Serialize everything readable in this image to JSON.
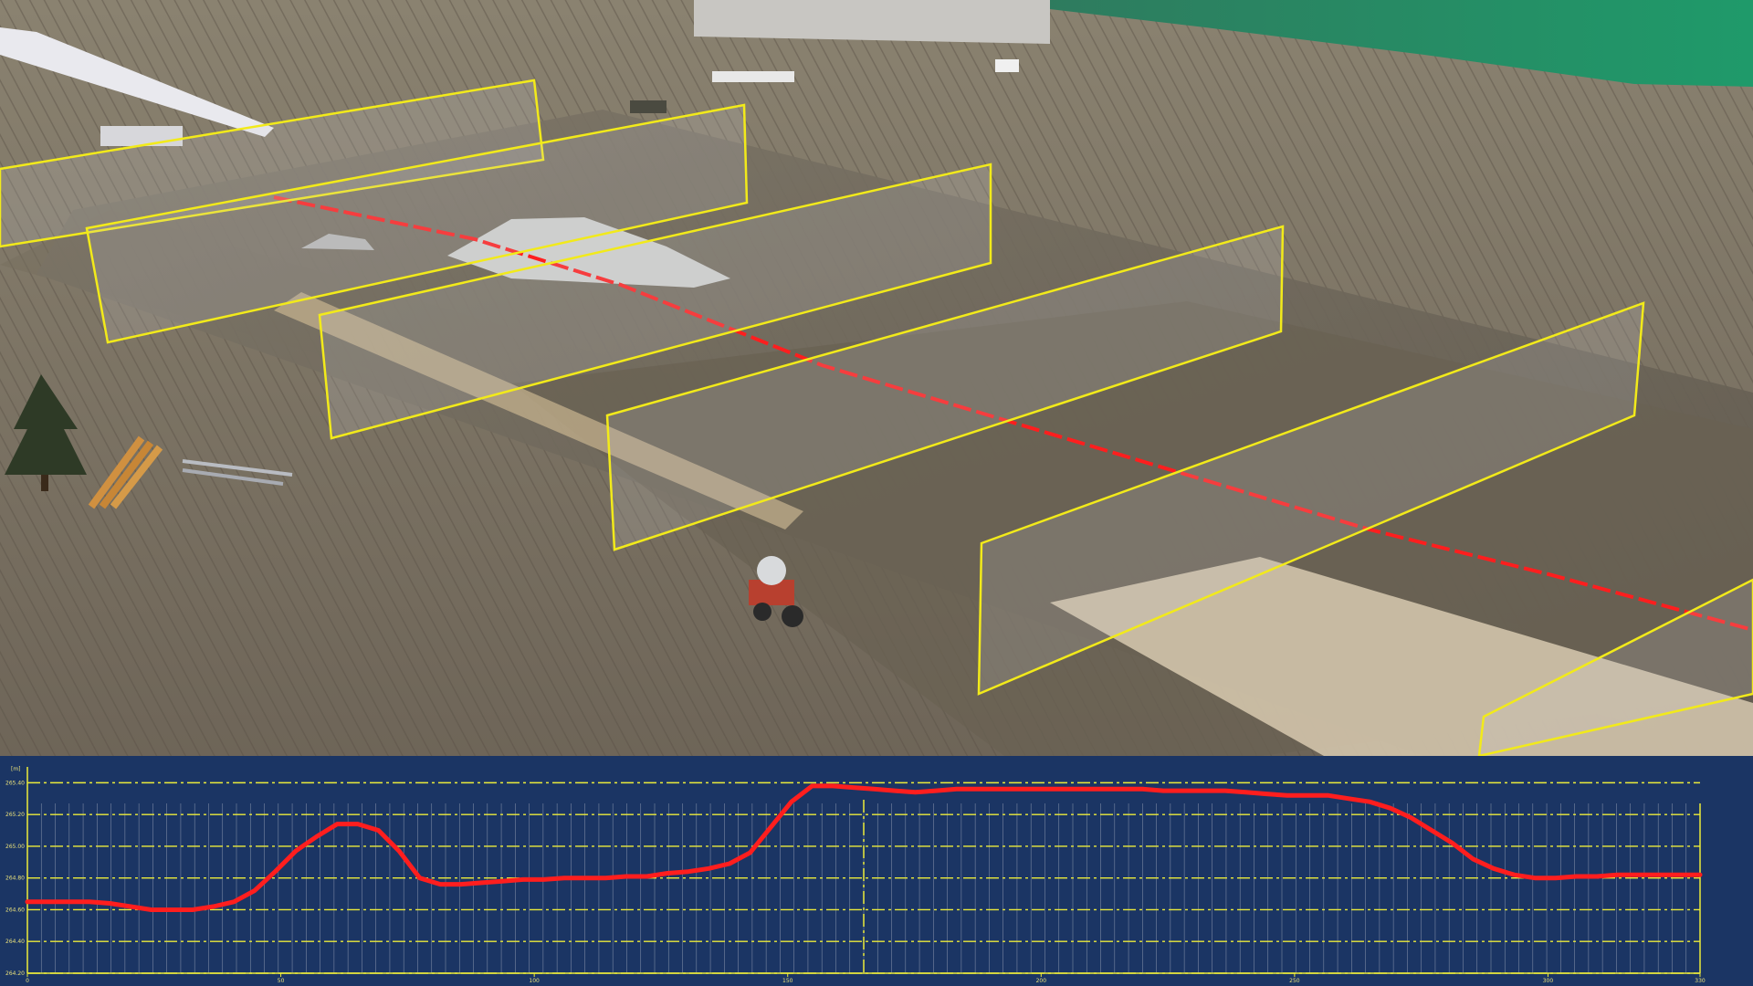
{
  "chart_data": {
    "type": "line",
    "title": "",
    "xlabel": "",
    "ylabel": "",
    "y_unit_label": "[m]",
    "x": [
      0,
      5,
      10,
      15,
      20,
      25,
      30,
      35,
      40,
      45,
      50,
      55,
      60,
      65,
      70,
      75,
      80,
      85,
      90,
      95,
      100,
      105,
      110,
      115,
      120,
      125,
      130,
      135,
      140,
      145,
      150,
      155,
      160,
      165,
      170,
      175,
      180,
      185,
      190,
      195,
      200,
      205,
      210,
      215,
      220,
      225,
      230,
      235,
      240,
      245,
      250,
      255,
      260,
      265,
      270,
      275,
      280,
      285,
      290,
      295,
      300,
      305,
      310,
      315,
      320,
      325,
      330
    ],
    "xlim": [
      0,
      330
    ],
    "x_tick_labels": [
      "0",
      "50",
      "100",
      "150",
      "200",
      "250",
      "300",
      "330"
    ],
    "y_tick_labels": [
      "264.20",
      "264.40",
      "264.60",
      "264.80",
      "265.00",
      "265.20",
      "265.40"
    ],
    "ylim": [
      264.2,
      265.5
    ],
    "series": [
      {
        "color": "#ff1e1e",
        "values": [
          264.65,
          264.65,
          264.65,
          264.65,
          264.64,
          264.62,
          264.6,
          264.6,
          264.6,
          264.62,
          264.65,
          264.72,
          264.84,
          264.97,
          265.06,
          265.14,
          265.14,
          265.1,
          264.97,
          264.8,
          264.76,
          264.76,
          264.77,
          264.78,
          264.79,
          264.79,
          264.8,
          264.8,
          264.8,
          264.81,
          264.81,
          264.83,
          264.84,
          264.86,
          264.89,
          264.96,
          265.12,
          265.28,
          265.38,
          265.38,
          265.37,
          265.36,
          265.35,
          265.34,
          265.35,
          265.36,
          265.36,
          265.36,
          265.36,
          265.36,
          265.36,
          265.36,
          265.36,
          265.36,
          265.36,
          265.35,
          265.35,
          265.35,
          265.35,
          265.34,
          265.33,
          265.32,
          265.32,
          265.32,
          265.3,
          265.28,
          265.24,
          265.18,
          265.1,
          265.02,
          264.92,
          264.86,
          264.82,
          264.8,
          264.8,
          264.81,
          264.81,
          264.82,
          264.82,
          264.82,
          264.82,
          264.82
        ]
      }
    ],
    "grid": true,
    "legend": "none",
    "marker_x": 165
  },
  "colors": {
    "profile_background": "#1b3564",
    "grid": "#ecec3a",
    "profile_line": "#ff1e1e",
    "section_planes": "#f2ea1a",
    "accent_bar": "#1f4d8f"
  },
  "scene": {
    "description_free": true,
    "tractor_icon": "tractor-icon",
    "tree_icon": "tree-icon"
  }
}
